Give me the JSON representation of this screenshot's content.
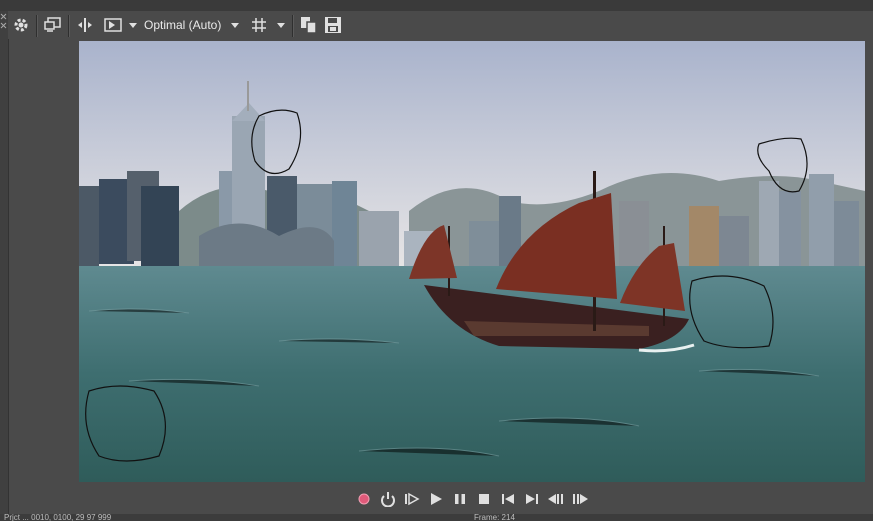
{
  "toolbar": {
    "quality_label": "Optimal (Auto)",
    "icons": [
      "settings-gear-icon",
      "external-monitor-icon",
      "split-screen-icon",
      "overlay-icon",
      "grid-icon",
      "copy-snapshot-icon",
      "save-snapshot-icon"
    ]
  },
  "transport": {
    "icons": [
      "record-icon",
      "loop-icon",
      "play-from-start-icon",
      "play-icon",
      "pause-icon",
      "stop-icon",
      "previous-frame-start-icon",
      "next-frame-end-icon",
      "previous-frame-icon",
      "next-frame-icon"
    ]
  },
  "status": {
    "left": "Prjct ... 0010, 0100, 29 97 999",
    "right": "Frame: 214"
  },
  "colors": {
    "background": "#4a4a4a",
    "record": "#e05a7a",
    "icon": "#e0e0e0"
  }
}
